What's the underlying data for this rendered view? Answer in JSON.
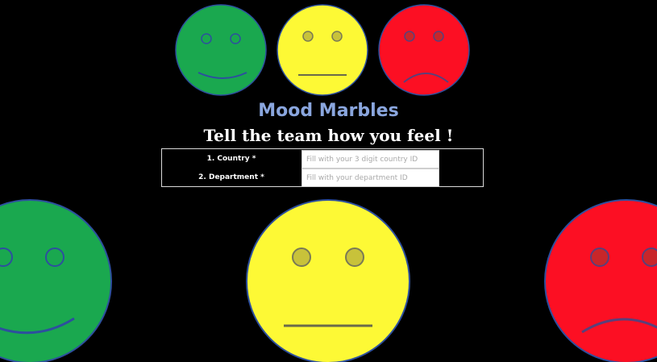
{
  "header": {
    "title": "Mood Marbles",
    "tagline": "Tell the team how you feel !"
  },
  "form": {
    "fields": [
      {
        "label": "1. Country *",
        "value": "",
        "placeholder": "Fill with your 3 digit country ID"
      },
      {
        "label": "2. Department *",
        "value": "",
        "placeholder": "Fill with your department ID"
      }
    ]
  },
  "moods": {
    "happy": {
      "icon": "happy-face-icon",
      "color": "#1aa84f"
    },
    "neutral": {
      "icon": "neutral-face-icon",
      "color": "#fdf935"
    },
    "sad": {
      "icon": "sad-face-icon",
      "color": "#fc0f23"
    }
  },
  "colors": {
    "background": "#000000",
    "title": "#8aa6de",
    "outline": "#2d4f9e"
  }
}
